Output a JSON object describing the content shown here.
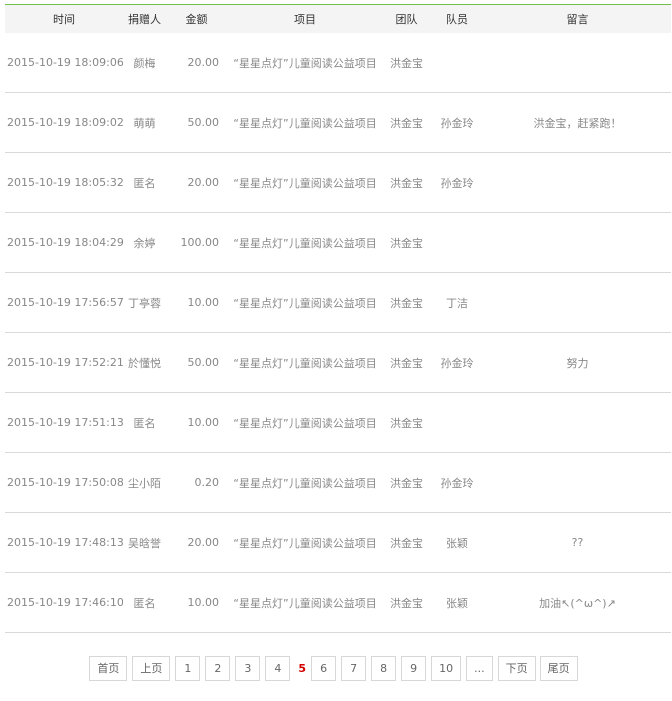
{
  "columns": [
    "时间",
    "捐赠人",
    "金额",
    "项目",
    "团队",
    "队员",
    "留言"
  ],
  "rows": [
    {
      "time": "2015-10-19 18:09:06",
      "donor": "颜梅",
      "amount": "20.00",
      "project": "“星星点灯”儿童阅读公益项目",
      "team": "洪金宝",
      "member": "",
      "message": ""
    },
    {
      "time": "2015-10-19 18:09:02",
      "donor": "萌萌",
      "amount": "50.00",
      "project": "“星星点灯”儿童阅读公益项目",
      "team": "洪金宝",
      "member": "孙金玲",
      "message": "洪金宝，赶紧跑！"
    },
    {
      "time": "2015-10-19 18:05:32",
      "donor": "匿名",
      "amount": "20.00",
      "project": "“星星点灯”儿童阅读公益项目",
      "team": "洪金宝",
      "member": "孙金玲",
      "message": ""
    },
    {
      "time": "2015-10-19 18:04:29",
      "donor": "余婷",
      "amount": "100.00",
      "project": "“星星点灯”儿童阅读公益项目",
      "team": "洪金宝",
      "member": "",
      "message": ""
    },
    {
      "time": "2015-10-19 17:56:57",
      "donor": "丁亭蓉",
      "amount": "10.00",
      "project": "“星星点灯”儿童阅读公益项目",
      "team": "洪金宝",
      "member": "丁洁",
      "message": ""
    },
    {
      "time": "2015-10-19 17:52:21",
      "donor": "於懂悦",
      "amount": "50.00",
      "project": "“星星点灯”儿童阅读公益项目",
      "team": "洪金宝",
      "member": "孙金玲",
      "message": "努力"
    },
    {
      "time": "2015-10-19 17:51:13",
      "donor": "匿名",
      "amount": "10.00",
      "project": "“星星点灯”儿童阅读公益项目",
      "team": "洪金宝",
      "member": "",
      "message": ""
    },
    {
      "time": "2015-10-19 17:50:08",
      "donor": "尘小陌",
      "amount": "0.20",
      "project": "“星星点灯”儿童阅读公益项目",
      "team": "洪金宝",
      "member": "孙金玲",
      "message": ""
    },
    {
      "time": "2015-10-19 17:48:13",
      "donor": "吴晗誉",
      "amount": "20.00",
      "project": "“星星点灯”儿童阅读公益项目",
      "team": "洪金宝",
      "member": "张颖",
      "message": "??"
    },
    {
      "time": "2015-10-19 17:46:10",
      "donor": "匿名",
      "amount": "10.00",
      "project": "“星星点灯”儿童阅读公益项目",
      "team": "洪金宝",
      "member": "张颖",
      "message": "加油↖(^ω^)↗"
    }
  ],
  "pagination": {
    "first": "首页",
    "prev": "上页",
    "pages": [
      "1",
      "2",
      "3",
      "4",
      "5",
      "6",
      "7",
      "8",
      "9",
      "10"
    ],
    "current": "5",
    "ellipsis": "...",
    "next": "下页",
    "last": "尾页"
  },
  "colors": {
    "accent_line": "#6fbf4a",
    "current_page": "#d40000",
    "header_bg": "#f4f4f4",
    "row_border": "#d9d9d9"
  }
}
